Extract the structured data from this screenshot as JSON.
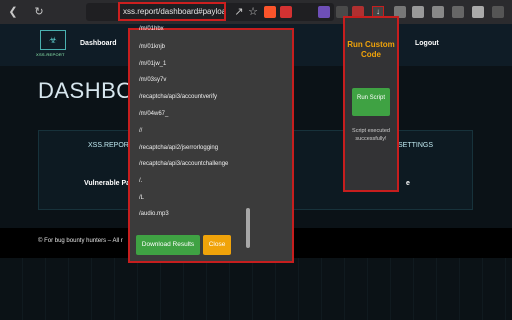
{
  "browser": {
    "url": "xss.report/dashboard#payloads"
  },
  "site": {
    "logo_text": "XSS.REPORT",
    "nav": {
      "dashboard": "Dashboard",
      "logout": "Logout"
    },
    "page_title": "DASHBOARD",
    "panel": {
      "tab_left": "XSS.REPORT",
      "tab_right": "SETTINGS",
      "heading_left": "Vulnerable Pa",
      "heading_right": "e"
    },
    "footer": "© For bug bounty hunters – All r"
  },
  "popup": {
    "payloads": [
      "/m/01hbx",
      "/m/01knjb",
      "/m/01jw_1",
      "/m/03sy7v",
      "/recaptcha/api3/accountverify",
      "/m/04w67_",
      "//",
      "/recaptcha/api2/jserrorlogging",
      "/recaptcha/api3/accountchallenge",
      "/.",
      "/L",
      "/audio.mp3"
    ],
    "download_label": "Download Results",
    "close_label": "Close"
  },
  "extension": {
    "title": "Run Custom Code",
    "run_label": "Run Script",
    "status": "Script executed successfully!"
  }
}
